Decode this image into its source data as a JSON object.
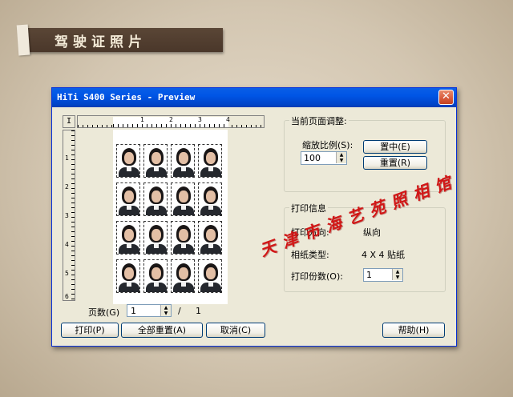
{
  "page": {
    "title": "驾驶证照片"
  },
  "dialog": {
    "title": "HiTi S400 Series - Preview",
    "close_glyph": "✕"
  },
  "preview": {
    "ruler_corner": "I",
    "ruler_numbers": [
      "1",
      "2",
      "3",
      "4"
    ],
    "v_ruler_numbers": [
      "1",
      "2",
      "3",
      "4",
      "5",
      "6"
    ],
    "photo_count": 16
  },
  "pagination": {
    "label": "页数(G)",
    "current": "1",
    "separator": "/",
    "total": "1"
  },
  "adjust": {
    "group_title": "当前页面调整:",
    "scale_label": "缩放比例(S):",
    "scale_value": "100",
    "center_button": "置中(E)",
    "reset_button": "重置(R)"
  },
  "print_info": {
    "group_title": "打印信息",
    "direction_label": "打印方向:",
    "direction_value": "纵向",
    "paper_label": "相纸类型:",
    "paper_value": "4 X 4 贴纸",
    "copies_label": "打印份数(O):",
    "copies_value": "1"
  },
  "footer": {
    "print_button": "打印(P)",
    "reset_all_button": "全部重置(A)",
    "cancel_button": "取消(C)",
    "help_button": "帮助(H)"
  },
  "watermark": {
    "text": "天津市海艺苑照相馆"
  },
  "colors": {
    "titlebar": "#0054e3",
    "dialog_bg": "#ece9d8",
    "watermark": "#d11616",
    "banner": "#4f3b2d"
  }
}
